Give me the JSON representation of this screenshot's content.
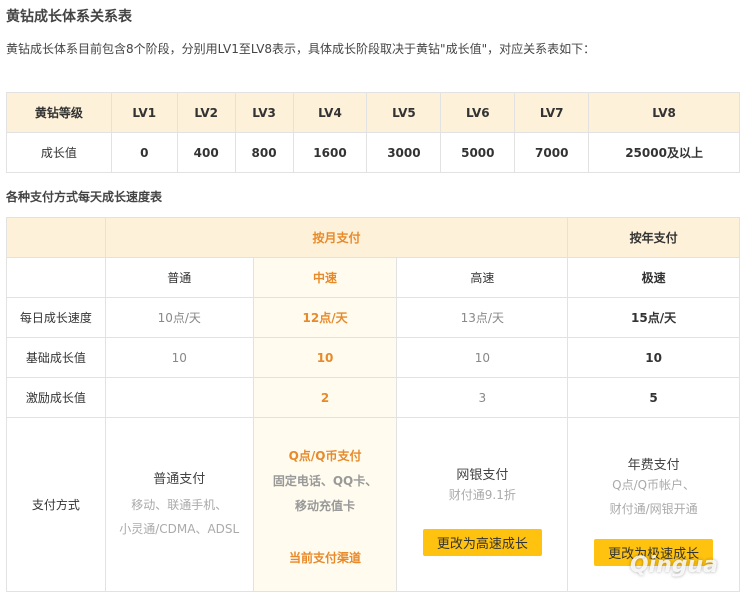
{
  "title": "黄钻成长体系关系表",
  "intro": "黄钻成长体系目前包含8个阶段，分别用LV1至LV8表示，具体成长阶段取决于黄钻\"成长值\"，对应关系表如下：",
  "level_table": {
    "header_label": "黄钻等级",
    "levels": [
      "LV1",
      "LV2",
      "LV3",
      "LV4",
      "LV5",
      "LV6",
      "LV7",
      "LV8"
    ],
    "value_label": "成长值",
    "values": [
      "0",
      "400",
      "800",
      "1600",
      "3000",
      "5000",
      "7000",
      "25000及以上"
    ]
  },
  "speed_title": "各种支付方式每天成长速度表",
  "speed_table": {
    "group_month": "按月支付",
    "group_year": "按年支付",
    "columns": [
      "普通",
      "中速",
      "高速",
      "极速"
    ],
    "rows": [
      {
        "label": "每日成长速度",
        "cells": [
          "10点/天",
          "12点/天",
          "13点/天",
          "15点/天"
        ]
      },
      {
        "label": "基础成长值",
        "cells": [
          "10",
          "10",
          "10",
          "10"
        ]
      },
      {
        "label": "激励成长值",
        "cells": [
          "",
          "2",
          "3",
          "5"
        ]
      }
    ],
    "pay_label": "支付方式",
    "pay": {
      "normal": {
        "title": "普通支付",
        "lines": [
          "移动、联通手机、",
          "小灵通/CDMA、ADSL"
        ]
      },
      "medium": {
        "lines": [
          "Q点/Q币支付",
          "固定电话、QQ卡、",
          "移动充值卡"
        ],
        "current": "当前支付渠道"
      },
      "fast": {
        "title": "网银支付",
        "sub": "财付通9.1折",
        "button": "更改为高速成长"
      },
      "extreme": {
        "title": "年费支付",
        "lines": [
          "Q点/Q币帐户、",
          "财付通/网银开通"
        ],
        "button": "更改为极速成长"
      }
    }
  },
  "watermark": "Qingua"
}
